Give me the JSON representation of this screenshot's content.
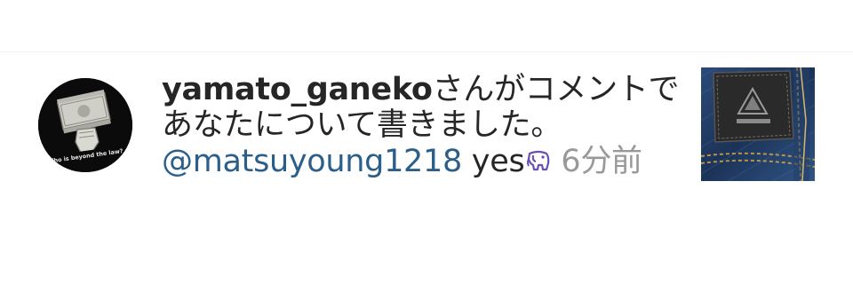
{
  "notification": {
    "username": "yamato_ganeko",
    "message_line1_suffix": "さんがコメントで",
    "message_line2": "あなたについて書きました。",
    "mention": "@matsuyoung1218",
    "comment": "yes",
    "emoji": "evernote-elephant-emoji",
    "timestamp": "6分前",
    "avatar": {
      "description_icon": "money-stack-avatar",
      "caption": "Who is beyond the law?"
    },
    "post_thumbnail": {
      "icon": "denim-jeans-thumbnail"
    }
  },
  "colors": {
    "text": "#262626",
    "mention": "#2b5f8a",
    "timestamp": "#999999",
    "emoji": "#6a4fb0"
  }
}
